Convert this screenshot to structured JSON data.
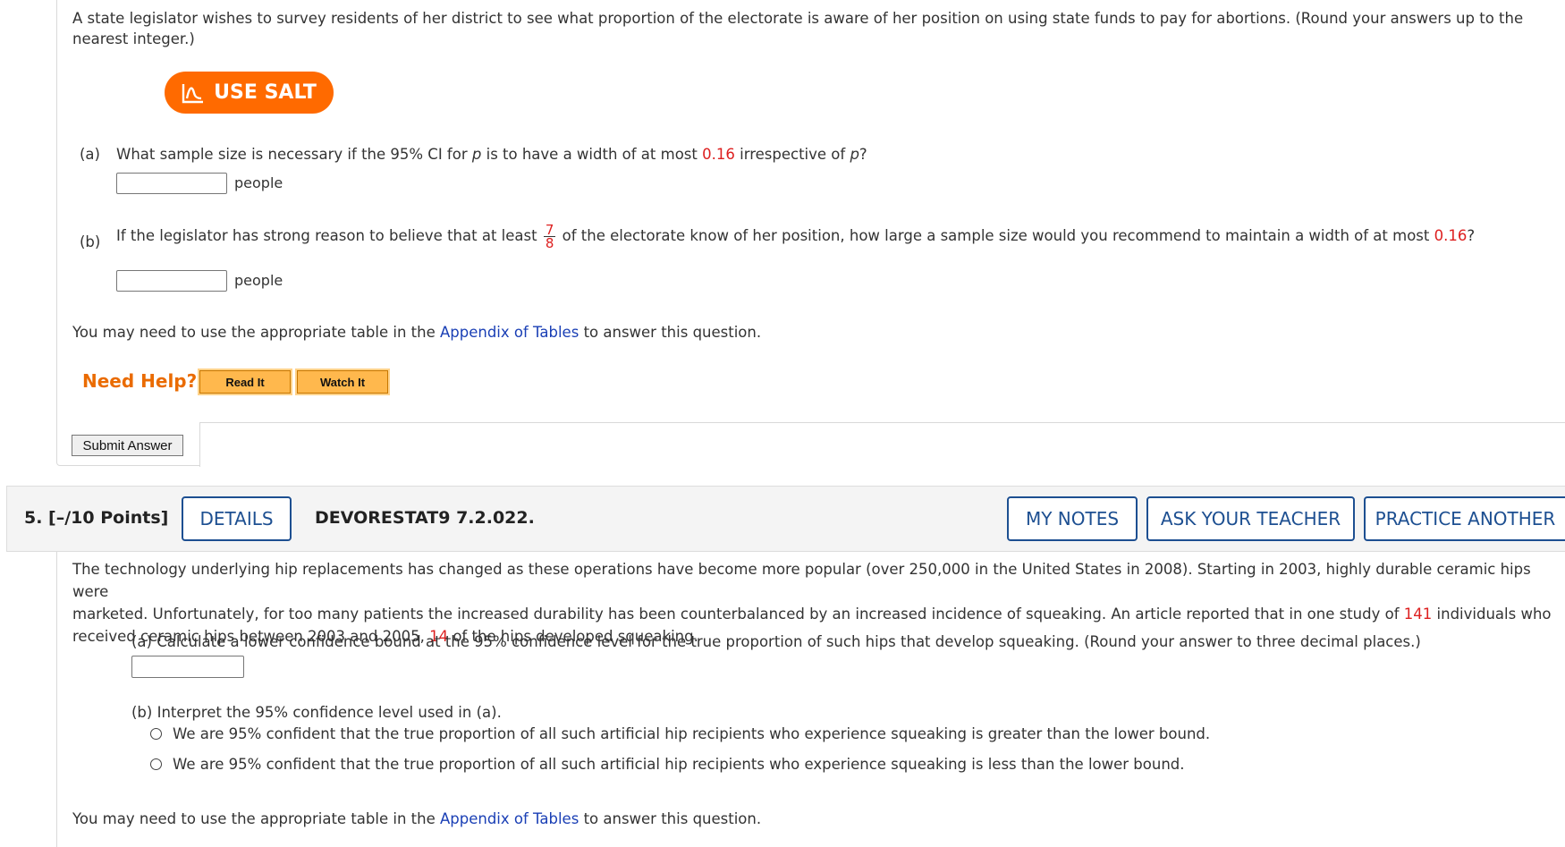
{
  "q4": {
    "intro_line1": "A state legislator wishes to survey residents of her district to see what proportion of the electorate is aware of her position on using state funds to pay for abortions. (Round your answers up to the",
    "intro_line2": "nearest integer.)",
    "salt_label": "USE SALT",
    "part_a": {
      "label": "(a)",
      "text_before": "What sample size is necessary if the 95% CI for",
      "var_p": "p",
      "text_mid": "is to have a width of at most",
      "width_value": "0.16",
      "text_after": "irrespective of",
      "var_p2": "p",
      "end": "?",
      "answer_value": "",
      "unit": "people"
    },
    "part_b": {
      "label": "(b)",
      "text_before": "If the legislator has strong reason to believe that at least",
      "frac_num": "7",
      "frac_den": "8",
      "text_after": "of the electorate know of her position, how large a sample size would you recommend to maintain a width of at most",
      "width_value": "0.16",
      "end": "?",
      "answer_value": "",
      "unit": "people"
    },
    "appendix_before": "You may need to use the appropriate table in the",
    "appendix_link": "Appendix of Tables",
    "appendix_after": "to answer this question.",
    "need_help": "Need Help?",
    "read_it": "Read It",
    "watch_it": "Watch It",
    "submit": "Submit Answer"
  },
  "q5": {
    "title": "5.  [–/10 Points]",
    "details": "DETAILS",
    "code": "DEVORESTAT9 7.2.022.",
    "my_notes": "MY NOTES",
    "ask_teacher": "ASK YOUR TEACHER",
    "practice": "PRACTICE ANOTHER",
    "text_1": "The technology underlying hip replacements has changed as these operations have become more popular (over 250,000 in the United States in 2008). Starting in 2003, highly durable ceramic hips were",
    "text_2_before": "marketed. Unfortunately, for too many patients the increased durability has been counterbalanced by an increased incidence of squeaking. An article reported that in one study of",
    "n_value": "141",
    "text_2_after": "individuals who",
    "text_3_before": "received ceramic hips between 2003 and 2005,",
    "x_value": "14",
    "text_3_after": "of the hips developed squeaking.",
    "part_a": "(a) Calculate a lower confidence bound at the 95% confidence level for the true proportion of such hips that develop squeaking. (Round your answer to three decimal places.)",
    "part_a_value": "",
    "part_b": "(b) Interpret the 95% confidence level used in (a).",
    "option_1": "We are 95% confident that the true proportion of all such artificial hip recipients who experience squeaking is greater than the lower bound.",
    "option_2": "We are 95% confident that the true proportion of all such artificial hip recipients who experience squeaking is less than the lower bound.",
    "appendix_before": "You may need to use the appropriate table in the",
    "appendix_link": "Appendix of Tables",
    "appendix_after": "to answer this question."
  },
  "colors": {
    "salt_orange": "#ff6a00",
    "help_orange": "#ea6b00",
    "value_red": "#dd1f1f",
    "link_blue": "#1a3fb5",
    "button_navy": "#1d4f91"
  }
}
